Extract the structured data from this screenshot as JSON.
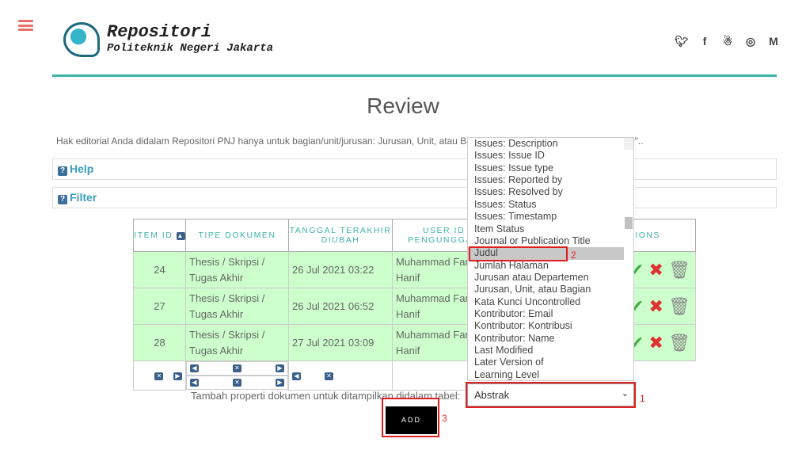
{
  "header": {
    "brand_title": "Repositori",
    "brand_subtitle": "Politeknik Negeri Jakarta",
    "social": [
      "twitter-icon",
      "facebook-icon",
      "snapchat-icon",
      "instagram-icon",
      "mendeley-icon"
    ]
  },
  "page": {
    "title": "Review",
    "notice": "Hak editorial Anda didalam Repositori PNJ hanya untuk bagian/unit/jurusan: Jurusan, Unit, atau Bagian \"Teknik Informatika dan Komputer\"..",
    "help": "Help",
    "filter": "Filter"
  },
  "table": {
    "headers": [
      "ITEM ID",
      "TIPE DOKUMEN",
      "TANGGAL TERAKHIR DIUBAH",
      "USER ID PENGUNGGAH",
      "ACTIONS"
    ],
    "rows": [
      {
        "id": "24",
        "type": "Thesis / Skripsi / Tugas Akhir",
        "date": "26 Jul 2021 03:22",
        "user": "Muhammad Farhan Hanif"
      },
      {
        "id": "27",
        "type": "Thesis / Skripsi / Tugas Akhir",
        "date": "26 Jul 2021 06:52",
        "user": "Muhammad Farhan Hanif"
      },
      {
        "id": "28",
        "type": "Thesis / Skripsi / Tugas Akhir",
        "date": "27 Jul 2021 03:09",
        "user": "Muhammad Farhan Hanif"
      }
    ],
    "row_bg": "#ccffcc"
  },
  "dropdown": {
    "options": [
      "Issues: Description",
      "Issues: Issue ID",
      "Issues: Issue type",
      "Issues: Reported by",
      "Issues: Resolved by",
      "Issues: Status",
      "Issues: Timestamp",
      "Item Status",
      "Journal or Publication Title",
      "Judul",
      "Jumlah Halaman",
      "Jurusan atau Departemen",
      "Jurusan, Unit, atau Bagian",
      "Kata Kunci Uncontrolled",
      "Kontributor: Email",
      "Kontributor: Kontribusi",
      "Kontributor: Name",
      "Last Modified",
      "Later Version of",
      "Learning Level"
    ],
    "highlighted": "Judul",
    "selected": "Abstrak"
  },
  "add_form": {
    "label": "Tambah properti dokumen untuk ditampilkan didalam tabel:",
    "button": "ADD"
  },
  "annotations": [
    "1",
    "2",
    "3"
  ],
  "colors": {
    "accent": "#3cb4a8",
    "annotation": "#e02020"
  }
}
